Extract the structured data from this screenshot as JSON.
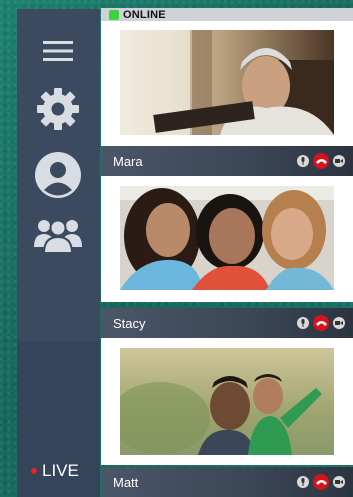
{
  "status": {
    "label": "ONLINE"
  },
  "sidebar": {
    "items": [
      {
        "icon": "menu-icon"
      },
      {
        "icon": "gear-icon"
      },
      {
        "icon": "user-icon"
      },
      {
        "icon": "group-icon"
      }
    ],
    "live_label": "LIVE"
  },
  "participants": [
    {
      "name": "Mara"
    },
    {
      "name": "Stacy"
    },
    {
      "name": "Matt"
    }
  ],
  "colors": {
    "sidebar": "#3b4a5e",
    "online": "#3bd43b",
    "live_dot": "#e5231f",
    "end_call": "#d4141a",
    "background": "#1f7a6c"
  }
}
